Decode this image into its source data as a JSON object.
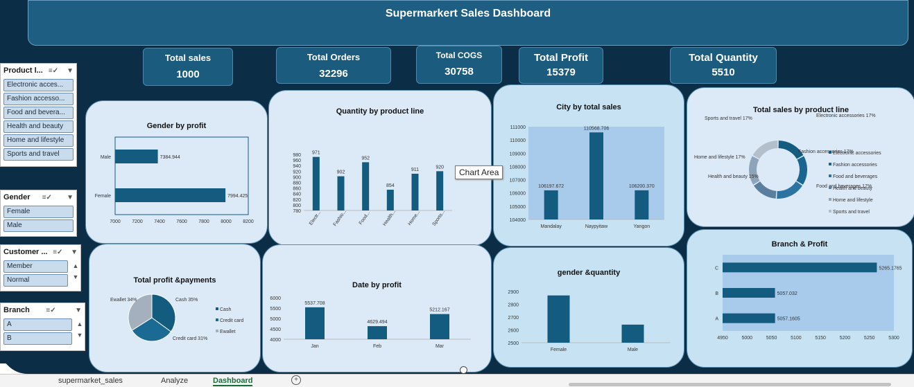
{
  "dashboard": {
    "title": "Supermarkert Sales Dashboard"
  },
  "kpis": [
    {
      "label": "Total sales",
      "value": "1000"
    },
    {
      "label": "Total Orders",
      "value": "32296"
    },
    {
      "label": "Total COGS",
      "value": "30758"
    },
    {
      "label": "Total Profit",
      "value": "15379"
    },
    {
      "label": "Total Quantity",
      "value": "5510"
    }
  ],
  "slicers": {
    "product_line": {
      "title": "Product l...",
      "items": [
        "Electronic acces...",
        "Fashion accesso...",
        "Food and bevera...",
        "Health and beauty",
        "Home and lifestyle",
        "Sports and travel"
      ]
    },
    "gender": {
      "title": "Gender",
      "items": [
        "Female",
        "Male"
      ]
    },
    "customer": {
      "title": "Customer ...",
      "items": [
        "Member",
        "Normal"
      ]
    },
    "branch": {
      "title": "Branch",
      "items": [
        "A",
        "B"
      ]
    }
  },
  "tooltip": {
    "text": "Chart Area"
  },
  "sheet_tabs": [
    "supermarket_sales",
    "Analyze",
    "Dashboard"
  ],
  "colors": {
    "bar": "#135b7f",
    "background": "#0b2e46",
    "card": "#dce9f7",
    "plot_area": "#a8caeb"
  },
  "chart_data": [
    {
      "id": "gender_profit",
      "type": "bar",
      "orientation": "horizontal",
      "title": "Gender by profit",
      "categories": [
        "Male",
        "Female"
      ],
      "values": [
        7384.944,
        7994.425
      ],
      "xlim": [
        7000,
        8200
      ],
      "xticks": [
        "7000",
        "7200",
        "7400",
        "7600",
        "7800",
        "8000",
        "8200"
      ],
      "data_labels": [
        "7384.944",
        "7994.425"
      ]
    },
    {
      "id": "qty_product",
      "type": "bar",
      "title": "Quantity by product line",
      "categories": [
        "Electr...",
        "Fashio...",
        "Food...",
        "Health...",
        "Home...",
        "Sports..."
      ],
      "values": [
        971,
        902,
        952,
        854,
        911,
        920
      ],
      "ylim": [
        780,
        980
      ],
      "yticks": [
        "980",
        "960",
        "940",
        "920",
        "900",
        "880",
        "860",
        "840",
        "820",
        "800",
        "780"
      ]
    },
    {
      "id": "city_sales",
      "type": "bar",
      "title": "City by total sales",
      "categories": [
        "Mandalay",
        "Naypyitaw",
        "Yangon"
      ],
      "values": [
        106197.672,
        110568.706,
        106200.37
      ],
      "data_labels": [
        "106197.672",
        "110568.706",
        "106200.370"
      ],
      "ylim": [
        104000,
        111000
      ],
      "yticks": [
        "111000",
        "110000",
        "109000",
        "108000",
        "107000",
        "106000",
        "105000",
        "104000"
      ]
    },
    {
      "id": "sales_product_line",
      "type": "pie",
      "style": "donut",
      "title": "Total sales by product line",
      "categories": [
        "Electronic accessories",
        "Fashion accessories",
        "Food and beverages",
        "Health and beauty",
        "Home and lifestyle",
        "Sports and travel"
      ],
      "values": [
        17,
        17,
        17,
        15,
        17,
        17
      ],
      "labels": [
        "Electronic accessories 17%",
        "Fashion accessories 17%",
        "Food and beverages 17%",
        "Health and beauty 15%",
        "Home and lifestyle 17%",
        "Sports and travel 17%"
      ],
      "legend": "right"
    },
    {
      "id": "profit_payments",
      "type": "pie",
      "title": "Total profit &payments",
      "categories": [
        "Cash",
        "Credit card",
        "Ewallet"
      ],
      "values": [
        35,
        31,
        34
      ],
      "labels": [
        "Cash 35%",
        "Credit card 31%",
        "Ewallet 34%"
      ],
      "legend": "right"
    },
    {
      "id": "date_profit",
      "type": "bar",
      "title": "Date by profit",
      "categories": [
        "Jan",
        "Feb",
        "Mar"
      ],
      "values": [
        5537.708,
        4629.494,
        5212.167
      ],
      "data_labels": [
        "5537.708",
        "4629.494",
        "5212.167"
      ],
      "ylim": [
        4000,
        6000
      ],
      "yticks": [
        "6000",
        "5500",
        "5000",
        "4500",
        "4000"
      ]
    },
    {
      "id": "gender_qty",
      "type": "bar",
      "title": "gender &quantity",
      "categories": [
        "Female",
        "Male"
      ],
      "values": [
        2869,
        2641
      ],
      "ylim": [
        2500,
        2900
      ],
      "yticks": [
        "2900",
        "2800",
        "2700",
        "2600",
        "2500"
      ]
    },
    {
      "id": "branch_profit",
      "type": "bar",
      "orientation": "horizontal",
      "title": "Branch & Profit",
      "categories": [
        "C",
        "B",
        "A"
      ],
      "values": [
        5265.1765,
        5057.032,
        5057.1605
      ],
      "data_labels": [
        "5265.1765",
        "5057.032",
        "5057.1605"
      ],
      "xlim": [
        4950,
        5300
      ],
      "xticks": [
        "4950",
        "5000",
        "5050",
        "5100",
        "5150",
        "5200",
        "5250",
        "5300"
      ]
    }
  ]
}
